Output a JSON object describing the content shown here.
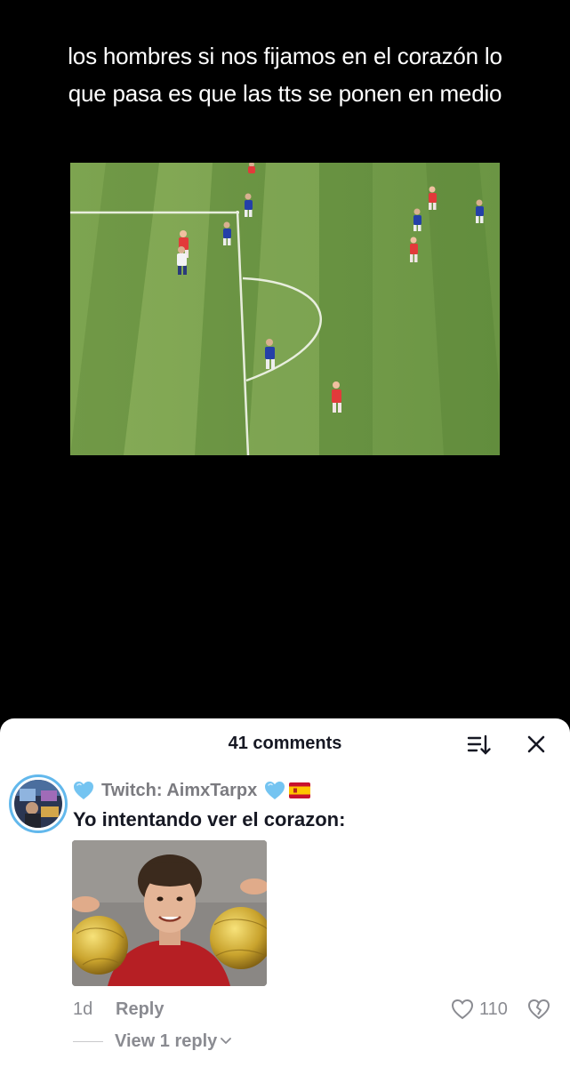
{
  "video": {
    "caption": "los hombres si nos fijamos en el corazón lo que pasa es que las tts se ponen en medio"
  },
  "comments_sheet": {
    "count_label": "41 comments",
    "sort_icon": "sort-icon",
    "close_icon": "close-icon"
  },
  "comment": {
    "username": "Twitch: AimxTarpx",
    "badges": [
      "light-blue-heart-emoji",
      "light-blue-heart-emoji",
      "spain-flag-emoji"
    ],
    "text": "Yo intentando ver el corazon:",
    "image_icon": "photo-icon",
    "time": "1d",
    "reply_label": "Reply",
    "likes": "110",
    "like_icon": "heart-outline-icon",
    "dislike_icon": "broken-heart-icon",
    "view_replies_label": "View 1 reply",
    "colors": {
      "avatar_ring": "#62b8ec",
      "heart_emoji": "#74c4f1",
      "meta_text": "#8a8b91"
    }
  }
}
